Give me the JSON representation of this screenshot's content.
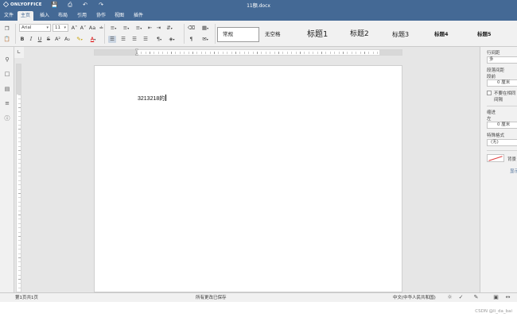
{
  "app": {
    "logo_text": "ONLYOFFICE",
    "doc_title": "11额.docx",
    "title_icons": [
      "save-icon",
      "print-icon",
      "undo-icon",
      "redo-icon"
    ]
  },
  "menu": {
    "tabs": [
      "文件",
      "主页",
      "插入",
      "布局",
      "引用",
      "协作",
      "视图",
      "插件"
    ],
    "active": "主页"
  },
  "toolbar": {
    "font_name": "Arial",
    "font_size": "11",
    "font_grow": "A˄",
    "font_shrink": "A˅",
    "case": "Aa",
    "bold": "B",
    "italic": "I",
    "underline": "U",
    "strike": "S",
    "superscript": "A²",
    "subscript": "A₂",
    "highlight": "✎",
    "font_color": "A",
    "paragraph_mark": "¶",
    "styles": [
      "常规",
      "无空格",
      "标题1",
      "标题2",
      "标题3",
      "标题4",
      "标题5"
    ],
    "selected_style": "常规",
    "accent_color": "#446995"
  },
  "document": {
    "text": "3213218的"
  },
  "right_panel": {
    "line_spacing_label": "行间距",
    "line_spacing_value": "多",
    "para_spacing_label": "段落间距",
    "before_label": "段前",
    "before_value": "0 厘米",
    "no_space_label": "不要在相同",
    "no_space_label_2": "间隔",
    "indent_label": "缩进",
    "left_label": "左",
    "left_value": "0 厘米",
    "special_label": "特殊格式",
    "special_value": "(无)",
    "background_label": "背景",
    "show_label": "显示"
  },
  "status": {
    "page_info": "第1页共1页",
    "save_status": "所有更改已保存",
    "language": "中文(中华人民共和国)"
  },
  "watermark": "CSDN @li_da_bai"
}
